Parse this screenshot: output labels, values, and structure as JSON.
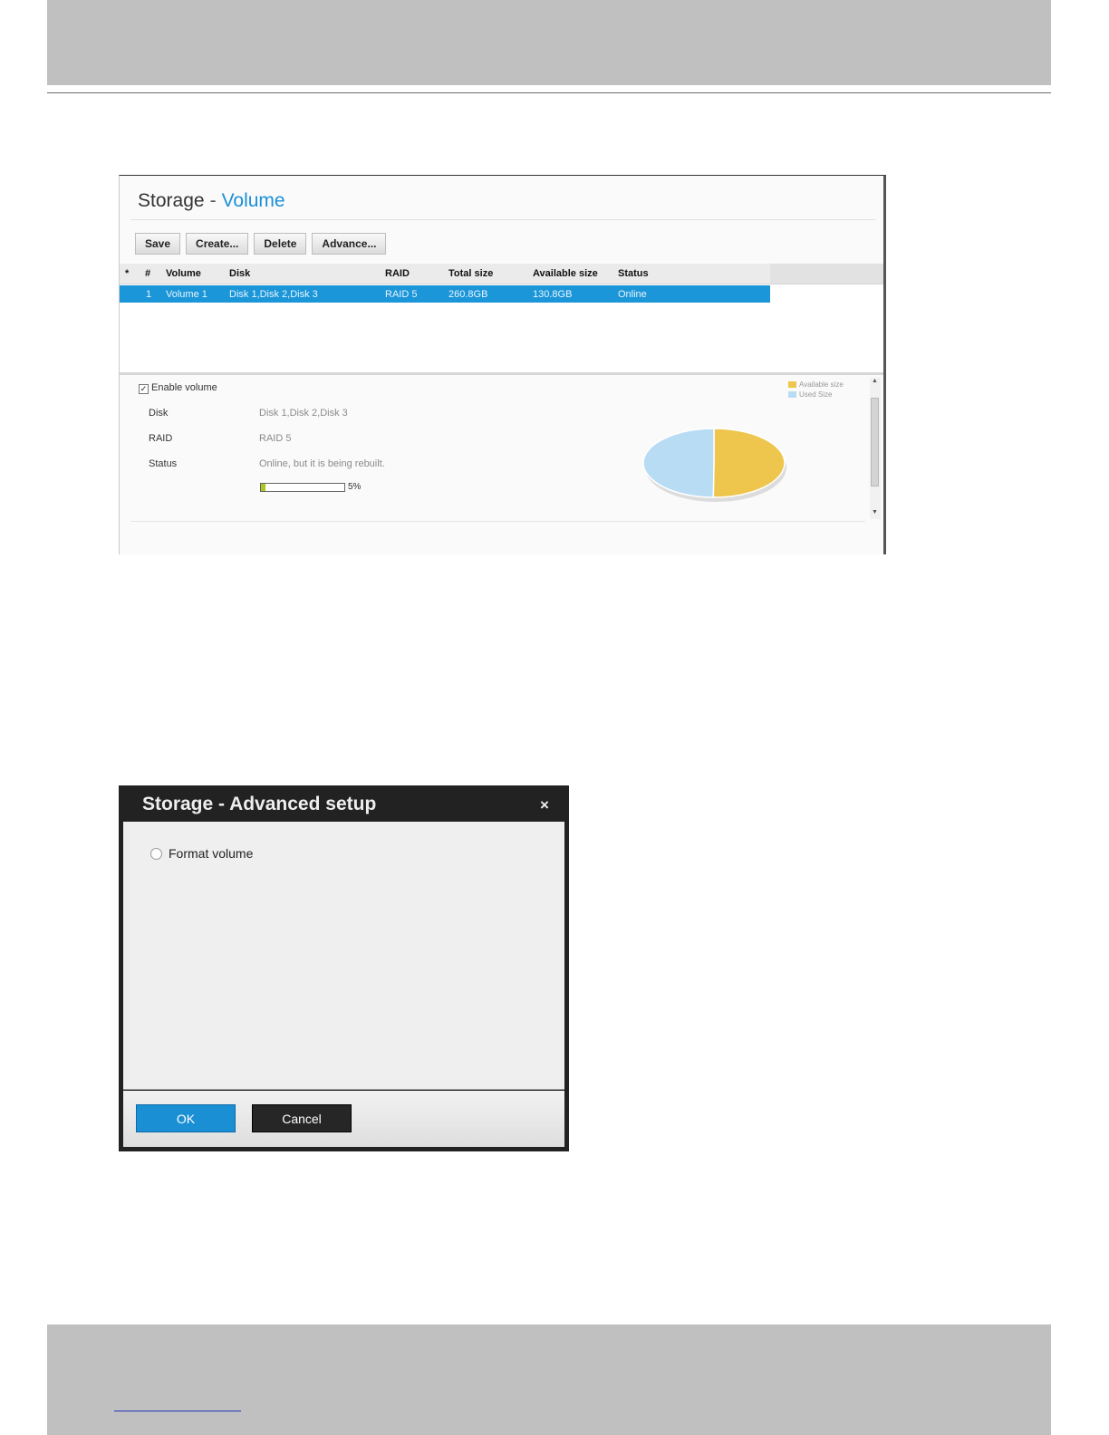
{
  "storage_panel": {
    "title": "Storage",
    "title_sep": "-",
    "title_accent": "Volume",
    "toolbar": {
      "save": "Save",
      "create": "Create...",
      "delete": "Delete",
      "advance": "Advance..."
    },
    "columns": [
      "*",
      "#",
      "Volume",
      "Disk",
      "RAID",
      "Total size",
      "Available size",
      "Status"
    ],
    "rows": [
      {
        "num": "1",
        "volume": "Volume 1",
        "disk": "Disk 1,Disk 2,Disk 3",
        "raid": "RAID 5",
        "total": "260.8GB",
        "available": "130.8GB",
        "status": "Online"
      }
    ],
    "enable_checked": "✓",
    "enable_label": "Enable volume",
    "details": {
      "disk_label": "Disk",
      "disk_value": "Disk 1,Disk 2,Disk 3",
      "raid_label": "RAID",
      "raid_value": "RAID 5",
      "status_label": "Status",
      "status_value": "Online, but it is being rebuilt."
    },
    "progress": {
      "value": 0.05,
      "label": "5%"
    },
    "chart_data": {
      "type": "pie",
      "labels": [
        "Available size",
        "Used Size"
      ],
      "values": [
        130.8,
        130.0
      ],
      "colors": [
        "#eec64e",
        "#b9dcf5"
      ],
      "legend": "top-right"
    }
  },
  "dialog": {
    "title": "Storage - Advanced setup",
    "close": "×",
    "option_label": "Format volume",
    "ok": "OK",
    "cancel": "Cancel"
  },
  "icons": {
    "close": "close-icon",
    "radio": "radio-button",
    "checkbox": "checkbox-icon"
  },
  "colors": {
    "accent": "#1a8fd8",
    "selected_row": "#1b96d8",
    "ok_button": "#1b8fd4"
  }
}
